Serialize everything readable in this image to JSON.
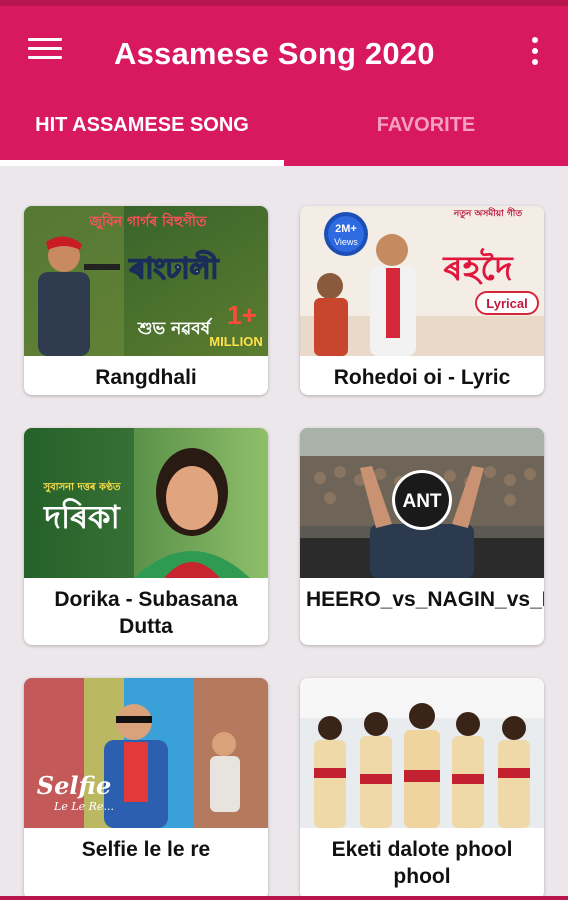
{
  "app": {
    "title": "Assamese Song 2020",
    "colors": {
      "primary": "#d8185f",
      "primary_dark": "#b8154f",
      "tab_inactive": "#f5a0bf",
      "background": "#ece7ea"
    }
  },
  "toolbar": {
    "menu_icon": "hamburger-menu-icon",
    "more_icon": "more-vert-icon"
  },
  "tabs": [
    {
      "label": "HIT ASSAMESE SONG",
      "active": true
    },
    {
      "label": "FAVORITE",
      "active": false
    }
  ],
  "songs": [
    {
      "label": "Rangdhali",
      "thumb_text": {
        "top": "জুবিন গাৰ্গৰ বিহুগীত",
        "title": "ৰাংঢালী",
        "badge": "1+",
        "badge_sub": "MILLION",
        "bottom": "শুভ নৱবৰ্ষ"
      }
    },
    {
      "label": "Rohedoi oi - Lyric",
      "thumb_text": {
        "top": "নতুন অসমীয়া গীত",
        "views": "2M+",
        "views_sub": "Views",
        "title": "ৰহদৈ",
        "tag": "Lyrical"
      }
    },
    {
      "label": "Dorika - Subasana Dutta",
      "thumb_text": {
        "top": "সুবাসনা দত্তৰ কণ্ঠত",
        "title": "দৰিকা"
      }
    },
    {
      "label": "HEERO_vs_NAGIN_vs_HORN",
      "thumb_text": {
        "logo": "ANT"
      }
    },
    {
      "label": "Selfie le le re",
      "thumb_text": {
        "title": "Selfie",
        "sub": "Le Le Re..."
      }
    },
    {
      "label": "Eketi dalote phool phool",
      "thumb_text": {}
    }
  ]
}
